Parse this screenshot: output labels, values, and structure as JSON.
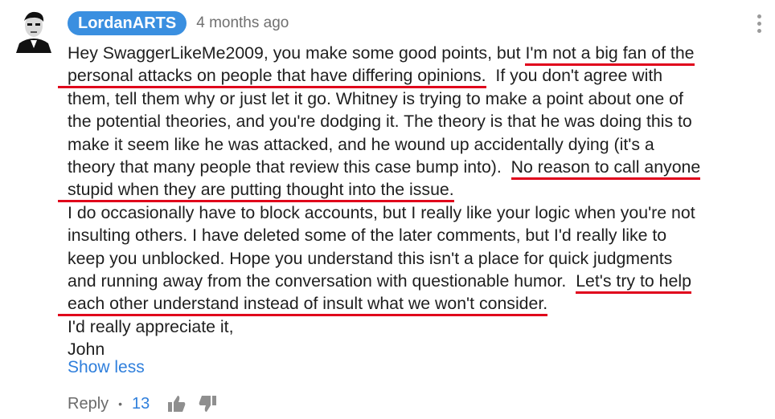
{
  "comment": {
    "author": "LordanARTS",
    "timestamp": "4 months ago",
    "lines": [
      [
        "Hey SwaggerLikeMe2009, you make some good points, but ",
        "I'm not a big fan of the"
      ],
      [
        "personal attacks on people that have differing opinions.",
        "  If you don't agree with"
      ],
      [
        "them, tell them why or just let it go.  Whitney is trying to make a point about one of"
      ],
      [
        "the potential theories, and you're dodging it.  The theory is that he was doing this to"
      ],
      [
        "make it seem like he was attacked, and he wound up accidentally dying (it's a"
      ],
      [
        "theory that many people that review this case bump into).  ",
        "No reason to call anyone"
      ],
      [
        "stupid when they are putting thought into the issue."
      ],
      [
        "I do occasionally have to block accounts, but I really like your logic when you're not"
      ],
      [
        "insulting others.  I have deleted some of the later comments, but I'd really like to"
      ],
      [
        "keep you unblocked.  Hope you understand this isn't a place for quick judgments"
      ],
      [
        "and running away from the conversation with questionable humor.  ",
        "Let's try to help"
      ],
      [
        "each other understand instead of insult what we won't consider."
      ],
      [
        "I'd really appreciate it,"
      ],
      [
        "John"
      ]
    ],
    "show_less": "Show less",
    "actions": {
      "reply": "Reply",
      "separator": "•",
      "like_count": "13"
    }
  },
  "colors": {
    "author_pill": "#3a8fe0",
    "link": "#2f7fdc",
    "highlight_underline": "#e0001b"
  },
  "icons": [
    "avatar",
    "more-vert-icon",
    "thumb-up-icon",
    "thumb-down-icon"
  ]
}
